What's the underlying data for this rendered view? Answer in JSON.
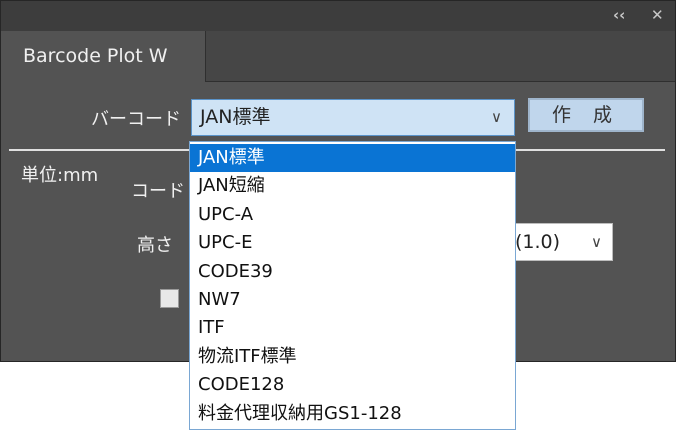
{
  "panel": {
    "title_buttons": {
      "collapse": "‹‹",
      "close": "✕"
    },
    "tab": {
      "label": "Barcode Plot W"
    }
  },
  "form": {
    "barcode_label": "バーコード",
    "selected_barcode": "JAN標準",
    "create_button": "作 成",
    "unit_label": "単位:mm",
    "code_label": "コード",
    "height_label": "高さ",
    "ratio_value": "(1.0)"
  },
  "dropdown": {
    "options": [
      "JAN標準",
      "JAN短縮",
      "UPC-A",
      "UPC-E",
      "CODE39",
      "NW7",
      "ITF",
      "物流ITF標準",
      "CODE128",
      "料金代理収納用GS1-128"
    ],
    "selected_index": 0
  },
  "colors": {
    "panel_bg": "#535353",
    "selection": "#0a74d4",
    "combo_bg": "#cfe3f5"
  }
}
